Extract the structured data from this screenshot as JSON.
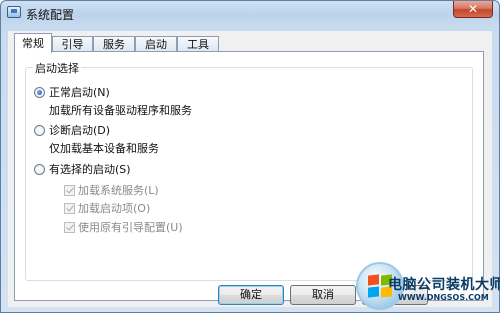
{
  "window": {
    "title": "系统配置",
    "close_glyph": "✕"
  },
  "tabs": [
    {
      "label": "常规",
      "active": true
    },
    {
      "label": "引导",
      "active": false
    },
    {
      "label": "服务",
      "active": false
    },
    {
      "label": "启动",
      "active": false
    },
    {
      "label": "工具",
      "active": false
    }
  ],
  "startup_selection": {
    "group_title": "启动选择",
    "normal": {
      "label": "正常启动(N)",
      "description": "加载所有设备驱动程序和服务",
      "checked": true
    },
    "diagnostic": {
      "label": "诊断启动(D)",
      "description": "仅加载基本设备和服务",
      "checked": false
    },
    "selective": {
      "label": "有选择的启动(S)",
      "checked": false,
      "options": [
        {
          "label": "加载系统服务(L)",
          "checked": true,
          "enabled": false
        },
        {
          "label": "加载启动项(O)",
          "checked": true,
          "enabled": false
        },
        {
          "label": "使用原有引导配置(U)",
          "checked": true,
          "enabled": false
        }
      ]
    }
  },
  "buttons": {
    "ok": "确定",
    "cancel": "取消"
  },
  "watermark": {
    "title": "电脑公司装机大师",
    "url": "WWW.DNGSOS.COM"
  }
}
